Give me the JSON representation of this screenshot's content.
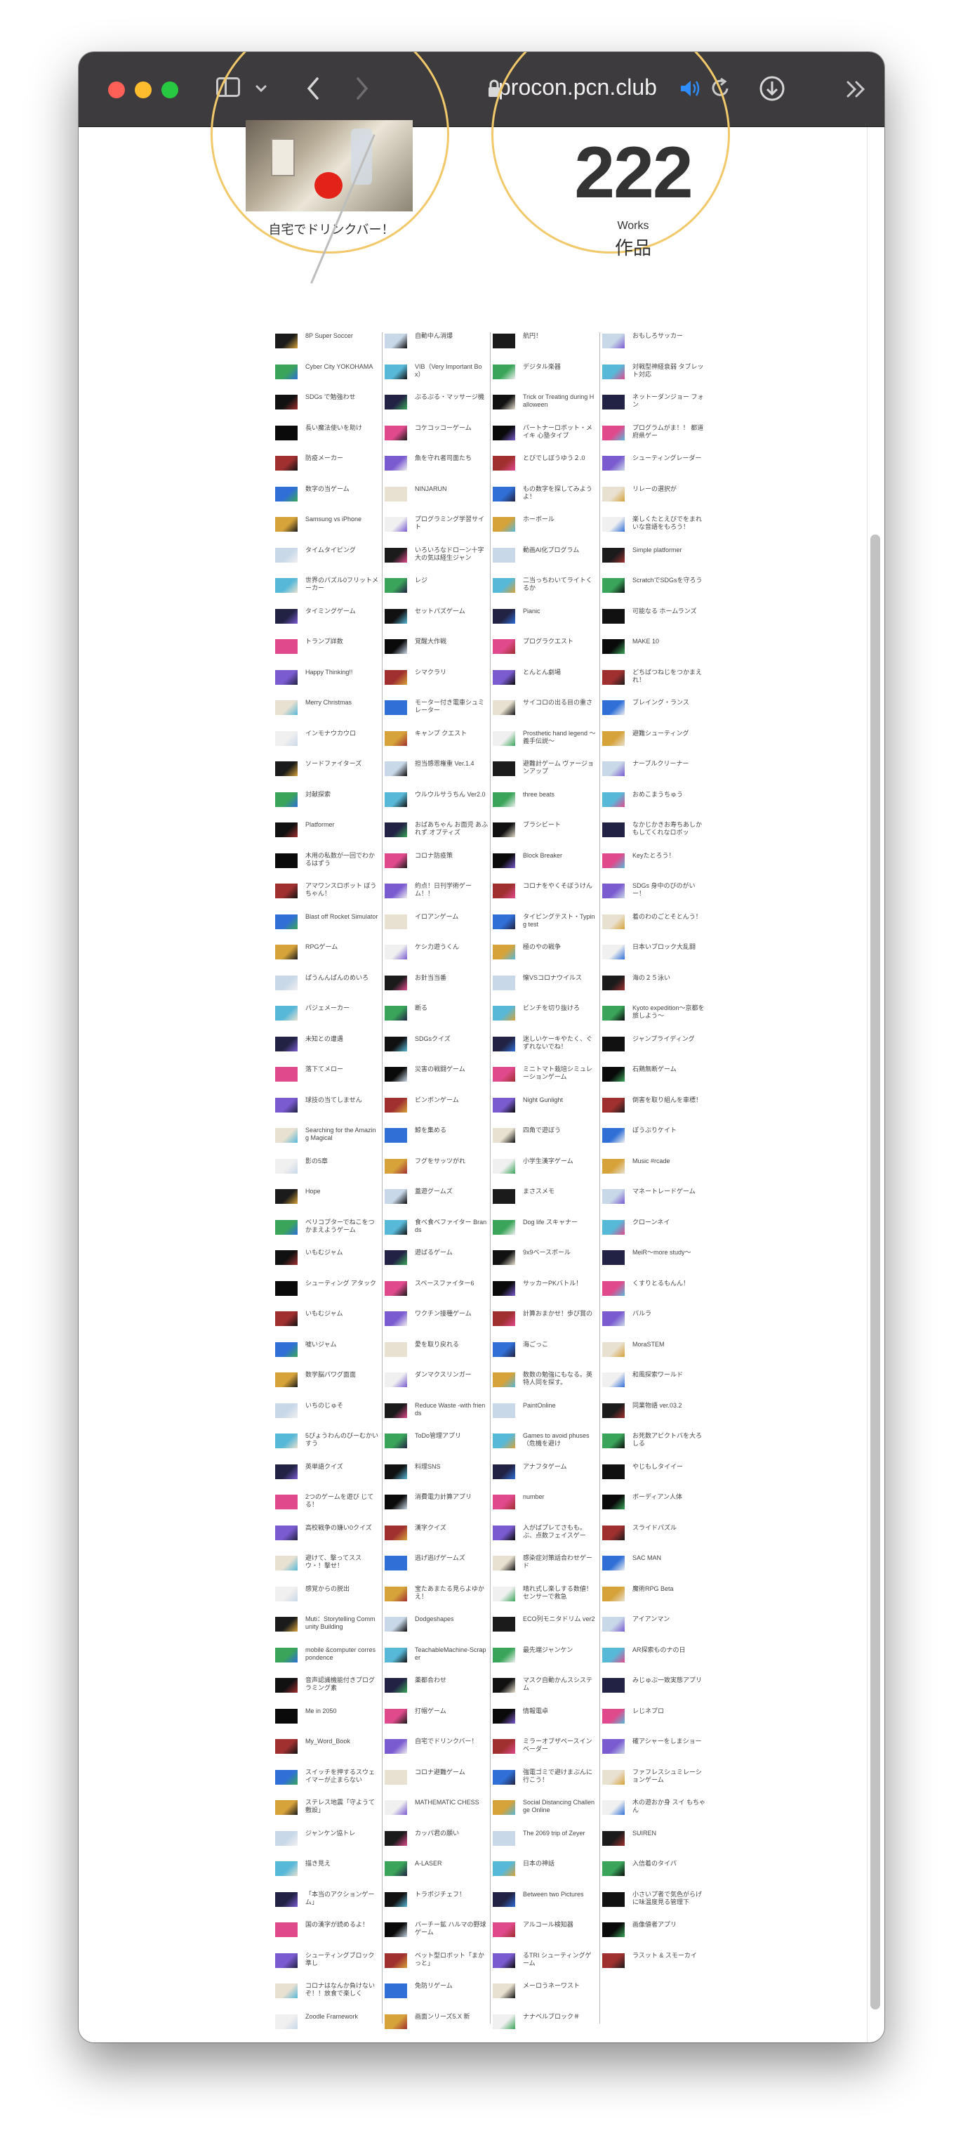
{
  "browser": {
    "url": "procon.pcn.club",
    "lock_icon": "lock-icon",
    "speaker_icon": "speaker-icon",
    "reload_icon": "reload-icon",
    "download_icon": "download-icon",
    "more_icon": "chevron-double-right-icon"
  },
  "hero": {
    "photo_caption": "自宅でドリンクバー！",
    "count": "222",
    "count_label_en": "Works",
    "count_label_ja": "作品"
  },
  "colors": {
    "accent_circle": "#f2c96a",
    "toolbar": "#3d3b3d"
  },
  "works": [
    [
      "8P Super Soccer",
      "Cyber City YOKOHAMA",
      "SDGs で勉強わせ",
      "長い魔法使いを助け",
      "防疫メーカー",
      "数字の当ゲーム",
      "Samsung vs iPhone",
      "タイムタイピング",
      "世界のパズル0フリットメーカー",
      "タイミングゲーム",
      "トランプ詳数",
      "Happy Thinking!!",
      "Merry Christmas",
      "インモナウカウロ",
      "ソードファイターズ",
      "対献探索",
      "Platformer",
      "木用の私数が一回でわかるはずう",
      "アマワンスロボット ぼうちゃん！",
      "Blast off Rocket Simulator",
      "RPGゲーム",
      "ぱうんんぱんのめいろ",
      "パジェメーカー",
      "未知との遭遇",
      "落下てメロー",
      "球技の当てしません",
      "Searching for the Amazing Magical",
      "影の5章",
      "Hope",
      "ベリコプターでねこをつかまえようゲーム",
      "いもむジャム",
      "シューティング アタック",
      "いもむジャム",
      "嘘いジャム",
      "数学脳パワグ面面",
      "いちのじゅそ",
      "5ぴょうわんのびーむかいすう",
      "英単語クイズ",
      "2つのゲームを遊び じてる！",
      "高校戦争の嫌い0クイズ",
      "避けて、撃ってススウ・！撃せ！",
      "感覚からの脱出",
      "Muti：Storytelling Community Building",
      "mobile &computer correspondence",
      "音声認識機能付きプログラミング素",
      "Me in 2050",
      "My_Word_Book",
      "スイッチを押するスウェイマーが止まらない",
      "ステレス地震「守ようて敷設」",
      "ジャンケン協トレ",
      "描き見え",
      "「本当のアクションゲーム」",
      "国の漢字が読めるよ！",
      "シューティングブロック 準し",
      "コロナはなんか負けないぞ！！放食で楽しく",
      "Zoodle Framework"
    ],
    [
      "自動中ん消爆",
      "VIB（Very Important Box）",
      "ぷるぷる・マッサージ機",
      "コケコッコーゲーム",
      "魚を守れ者司面たち",
      "NINJARUN",
      "プログラミング学習サイト",
      "いろいろなドローン十字大の気は経生ジャン",
      "レジ",
      "セットパズゲーム",
      "覚醒大作戦",
      "シマクラリ",
      "モーター付き電車シュミレーター",
      "キャンプ クエスト",
      "担当感恩権重 Ver.1.4",
      "ウルウルサうちん Ver2.0",
      "おばあちゃん お面児 あふれず オプティズ",
      "コロナ防疫策",
      "約点！日刊学術ゲーム！！",
      "イロアンゲーム",
      "ケシ力遊うくん",
      "お針当当番",
      "断る",
      "SDGsクイズ",
      "災害の戦闘ゲーム",
      "ビンボンゲーム",
      "鯨を集める",
      "フグをサッツがれ",
      "蓋遊グームズ",
      "食べ食べファイター Brands",
      "遊ばるゲーム",
      "スペースファイター6",
      "ワクチン接種ゲーム",
      "愛を取り戻れる",
      "ダンマクスリンガー",
      "Reduce Waste -with friends",
      "ToDo管理アプリ",
      "料理SNS",
      "消費電力計算アプリ",
      "漢字クイズ",
      "逃げ逃げゲームズ",
      "宝たあまたる見らよゆかえ！",
      "Dodgeshapes",
      "TeachableMachine-Scraper",
      "薬都合わせ",
      "打帽ゲーム",
      "自宅でドリンクバー！",
      "コロナ避難ゲーム",
      "MATHEMATIC CHESS",
      "カッパ君の願い",
      "A-LASER",
      "トラポジチェフ！",
      "バーチー鉱 ハルマの野球ゲーム",
      "ベット型ロボット「まかっと」",
      "免防リゲーム",
      "画面ンリーズ5.X 新"
    ],
    [
      "航円！",
      "デジタル楽器",
      "Trick or Treating during Halloween",
      "パートナーロボット・メイキ 心塾タイプ",
      "とびでしぼうゆう２.0",
      "もの数字を探してみようよ！",
      "ホーボール",
      "動画AI化プログラム",
      "二当っちわいてライトくるか",
      "Pianic",
      "プログラクエスト",
      "とんとん劇場",
      "サイコロの出る目の重さ",
      "Prosthetic hand legend ～義手伝説～",
      "避難計ゲーム ヴァージョンアップ",
      "three beats",
      "ブラシビート",
      "Block Breaker",
      "コロナをやくそぼうけん",
      "タイピングテスト・Typing test",
      "極のやの戦争",
      "懐VSコロナウイルス",
      "ビンチを切り抜けろ",
      "迷しいケーキやたく、ぐずれないでね！",
      "ミニトマト栽培シミュレーションゲーム",
      "Night Gunlight",
      "四角で遊ぼう",
      "小学生漢字ゲーム",
      "まさスメモ",
      "Dog life スキャナー",
      "9x9ベースボール",
      "サッカーPKバトル！",
      "計算おまかせ！歩び賞の",
      "海ごっこ",
      "数数の勉強にもなる。英特人同を探す。",
      "PaintOnline",
      "Games to avoid phuses（危機を避け",
      "アナフタゲーム",
      "number",
      "入がばプレてさもも。ぶ、点数フェイスゲー",
      "感染症対策話合わせゲード",
      "晴れ式し楽しする数値！センサーで救急",
      "ECO列モニタドリム ver2",
      "最先端ジャンケン",
      "マスク自動かんスシステム",
      "情報電卓",
      "ミラーオブザペースインベーダー",
      "強電ゴミで避けまぶんに行こう！",
      "Social Distancing Challenge Online",
      "The 2069 trip of Zeyer",
      "日本の神話",
      "Between two Pictures",
      "アルコール検知器",
      "るTRI シューティングゲーム",
      "メーロうネーワスト",
      "ナナベルブロック＃"
    ],
    [
      "おもしろサッカー",
      "対戦型神経衰弱 タブレット対応",
      "ネットーダンジョー フォン",
      "プログラムがま！！ 都道府県ゲー",
      "シューティングレーダー",
      "リレーの選択が",
      "楽しくたとえびでをまれいな音語をもろう！",
      "Simple platformer",
      "ScratchでSDGsを守ろう",
      "可能なる ホームランズ",
      "MAKE 10",
      "どちばつねじをつかまえれ！",
      "ブレイング・ランス",
      "避難シューティング",
      "ナーブルクリーナー",
      "おめこまうちゅう",
      "なかじかきお寿ちあしかもしてくれなロボッ",
      "Keyたとろう！",
      "SDGs 身中のびのがいー！",
      "着のわのごとそとんう！",
      "日本いブロック大乱闘",
      "海の２５泳い",
      "Kyoto expedition～京都を旅しよう～",
      "ジャンプライディング",
      "石鶏無断ゲーム",
      "倒害を取り組んを車標！",
      "ぽうぷりケイト",
      "Music #rcade",
      "マネートレードゲーム",
      "クローンネイ",
      "MeiR～more study～",
      "くすりとるもんん！",
      "パルラ",
      "MoraSTEM",
      "和風探索ワールド",
      "同業物語 ver.03.2",
      "お死数アピクトバを大ろしる",
      "やじもしタイイー",
      "ボーディアン人体",
      "スライドパズル",
      "SAC MAN",
      "魔術RPG Beta",
      "アイアンマン",
      "AR探索ものナの日",
      "みじゅぶ一致実態アプリ",
      "レじネプロ",
      "確アシャーをしまショー",
      "ファフレスシュミレーションゲーム",
      "木の遊おか身 スイ もちゃん",
      "SUIREN",
      "入信着のタイパ",
      "小さいプ者で気色がらげに味温度見る管理下",
      "画像値者アプリ",
      "ラスット & スモーカイ"
    ]
  ]
}
